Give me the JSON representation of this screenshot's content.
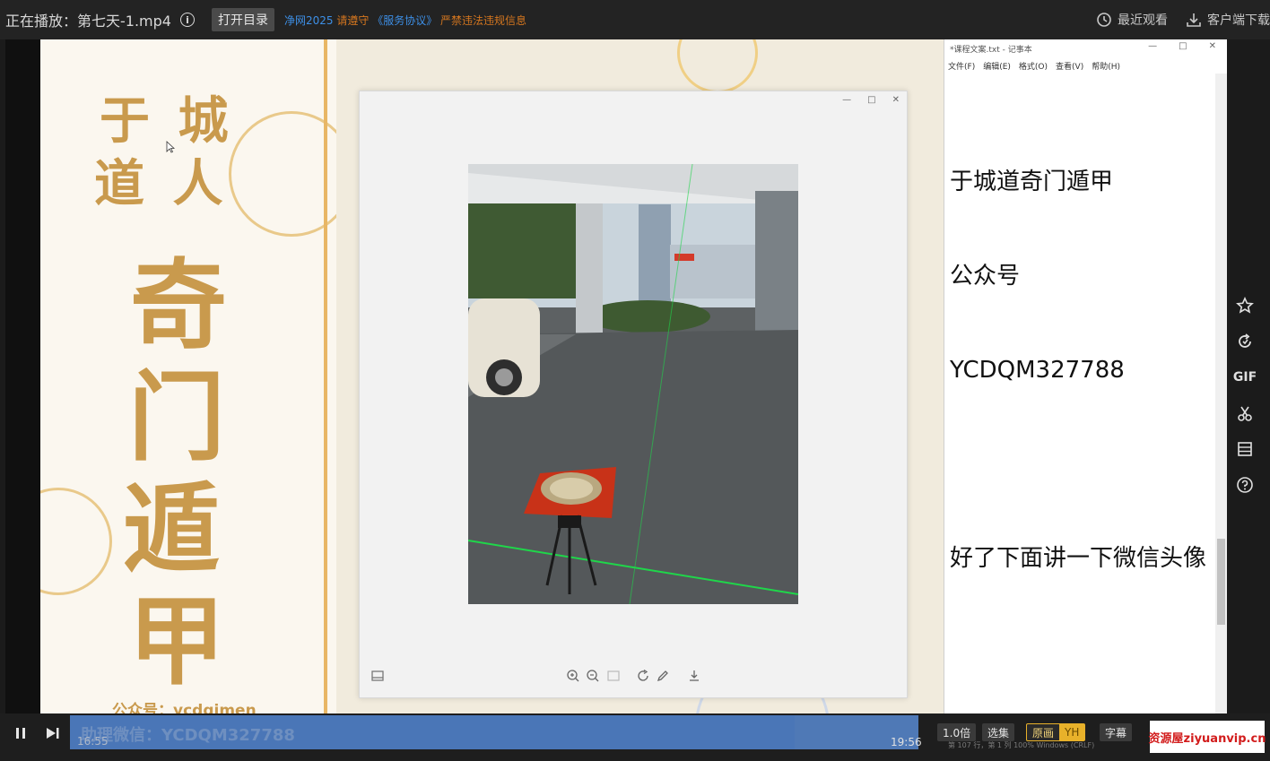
{
  "topbar": {
    "now_playing": "正在播放：第七天-1.mp4",
    "open_dir_label": "打开目录",
    "notice_part1": "净网2025",
    "notice_part2": "请遵守",
    "notice_part3": "《服务协议》",
    "notice_part4": "严禁违法违规信息",
    "recent_label": "最近观看",
    "download_label": "客户端下载"
  },
  "slide": {
    "title_small_1": "于 城",
    "title_small_2": "道 人",
    "big_chars": [
      "奇",
      "门",
      "遁",
      "甲"
    ],
    "public_account": "公众号：ycdqimen",
    "assistant": "助理微信：YCDQM327788"
  },
  "notepad": {
    "title": "*课程文案.txt - 记事本",
    "menu": [
      "文件(F)",
      "编辑(E)",
      "格式(O)",
      "查看(V)",
      "帮助(H)"
    ],
    "lines": [
      "于城道奇门遁甲",
      "公众号",
      "YCDQM327788",
      "",
      "好了下面讲一下微信头像"
    ],
    "status": "第 107 行，第 1 列     100%     Windows (CRLF)"
  },
  "rail": {
    "icons": [
      "star-icon",
      "refresh-icon",
      "gif-icon",
      "scissors-icon",
      "playlist-icon",
      "help-icon"
    ],
    "gif_label": "GIF"
  },
  "controls": {
    "current_time": "16:55",
    "total_time": "19:56",
    "speed": "1.0倍",
    "episodes": "选集",
    "quality_label": "原画",
    "quality_badge": "YH",
    "subtitle": "字幕",
    "progress": 0.854
  },
  "watermark": "资源屋ziyuanvip.cn",
  "colors": {
    "accent_blue": "#3d8fe6",
    "accent_orange": "#d4761f",
    "gold": "#c99a4d",
    "progress_blue": "#4f79b6",
    "quality_gold": "#e8b12a"
  }
}
